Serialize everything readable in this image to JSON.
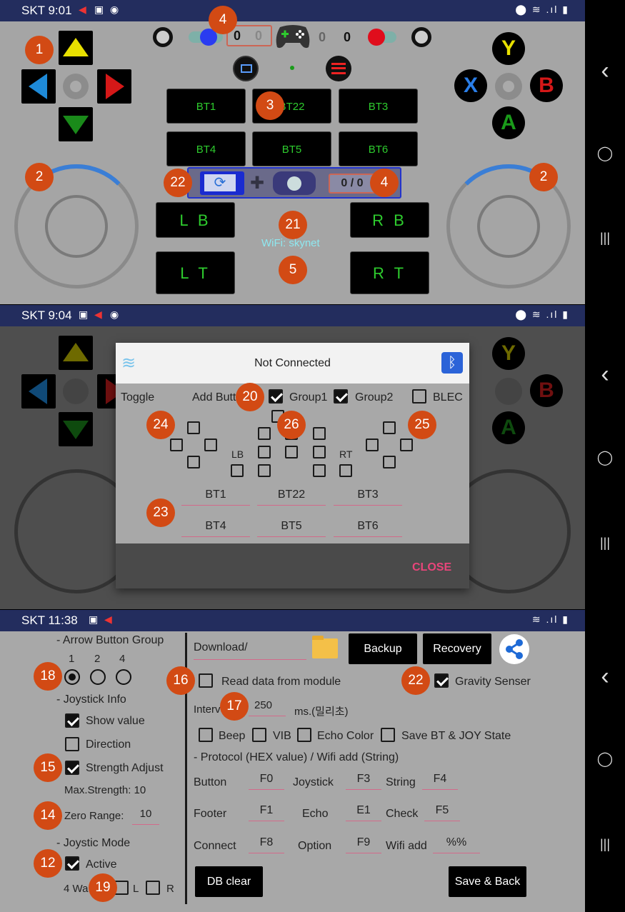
{
  "status_bars": [
    {
      "time": "SKT 9:01"
    },
    {
      "time": "SKT 9:04"
    },
    {
      "time": "SKT 11:38"
    }
  ],
  "gamepad": {
    "counter_left": [
      "0",
      "0"
    ],
    "counter_mid": "0",
    "counter_right": "0",
    "buttons_row1": [
      "BT1",
      "BT22",
      "BT3"
    ],
    "buttons_row2": [
      "BT4",
      "BT5",
      "BT6"
    ],
    "shoulder": {
      "lb": "L B",
      "lt": "L T",
      "rb": "R B",
      "rt": "R T"
    },
    "face": {
      "y": "Y",
      "x": "X",
      "b": "B",
      "a": "A"
    },
    "wifi_label": "WiFi: skynet",
    "toolbar_counter": "0 / 0"
  },
  "badges": {
    "p1": [
      "1",
      "4",
      "3",
      "2",
      "2",
      "22",
      "4",
      "21",
      "5"
    ],
    "p2": [
      "20",
      "24",
      "26",
      "25",
      "23"
    ],
    "p3": [
      "18",
      "16",
      "22",
      "17",
      "15",
      "14",
      "12",
      "19"
    ]
  },
  "dialog": {
    "title": "Not Connected",
    "toggle_label": "Toggle",
    "add_button_label": "Add Butt",
    "group1": "Group1",
    "group2": "Group2",
    "blec": "BLEC",
    "lb": "LB",
    "rt": "RT",
    "fields": [
      "BT1",
      "BT22",
      "BT3",
      "BT4",
      "BT5",
      "BT6"
    ],
    "close": "CLOSE"
  },
  "settings": {
    "arrow_group_title": "- Arrow Button Group",
    "arrow_options": [
      "1",
      "2",
      "4"
    ],
    "joystick_info_title": "- Joystick Info",
    "show_value": "Show value",
    "direction": "Direction",
    "strength_adjust": "Strength Adjust",
    "max_strength": "Max.Strength:  10",
    "zero_range_label": "Zero Range:",
    "zero_range_value": "10",
    "joystick_mode_title": "- Joystic Mode",
    "active": "Active",
    "four_way": "4 Wa",
    "l": "L",
    "r": "R",
    "path": "Download/",
    "backup": "Backup",
    "recovery": "Recovery",
    "read_module": "Read data from module",
    "gravity": "Gravity Senser",
    "interval_label": "Interv",
    "interval_value": "250",
    "interval_unit": "ms.(밀리초)",
    "beep": "Beep",
    "vib": "VIB",
    "echo_color": "Echo Color",
    "save_state": "Save BT & JOY State",
    "protocol_title": "- Protocol (HEX value) / Wifi add (String)",
    "rows": [
      [
        {
          "l": "Button",
          "v": "F0"
        },
        {
          "l": "Joystick",
          "v": "F3"
        },
        {
          "l": "String",
          "v": "F4"
        }
      ],
      [
        {
          "l": "Footer",
          "v": "F1"
        },
        {
          "l": "Echo",
          "v": "E1"
        },
        {
          "l": "Check",
          "v": "F5"
        }
      ],
      [
        {
          "l": "Connect",
          "v": "F8"
        },
        {
          "l": "Option",
          "v": "F9"
        },
        {
          "l": "Wifi add",
          "v": "%%"
        }
      ]
    ],
    "db_clear": "DB clear",
    "save_back": "Save & Back"
  },
  "colors": {
    "statusbar": "#232d5e",
    "gamepad_bg": "#a5a5a5",
    "badge": "#d24a14",
    "button_text": "#2ecc2e",
    "accent_blue": "#3a7ed6",
    "close_pink": "#e8457a"
  },
  "sys_nav": {
    "back": "‹",
    "home": "◯",
    "recents": "|||"
  }
}
